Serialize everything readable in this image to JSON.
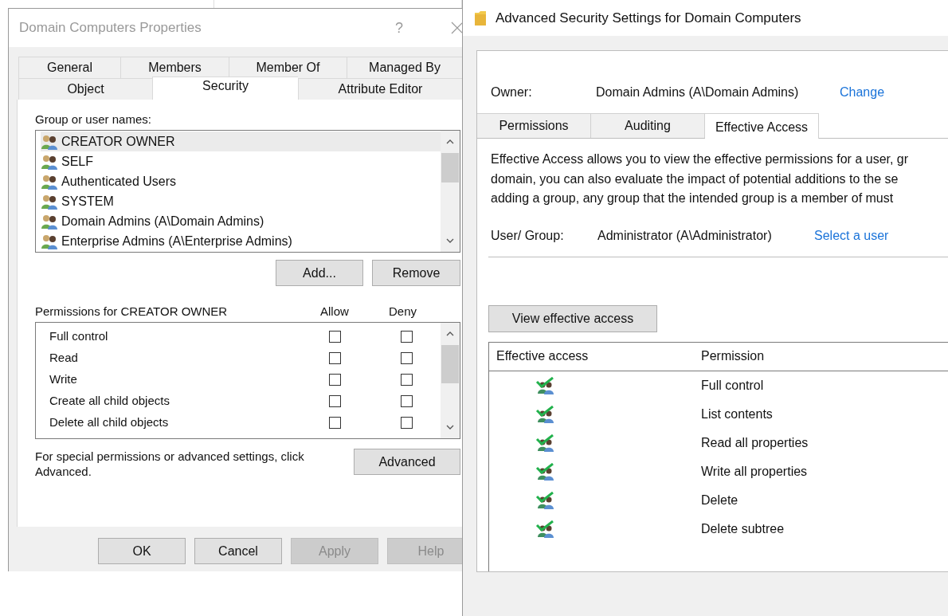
{
  "dialog": {
    "title": "Domain Computers Properties",
    "help_glyph": "?",
    "tab_rows": [
      [
        {
          "label": "General",
          "selected": false
        },
        {
          "label": "Members",
          "selected": false
        },
        {
          "label": "Member Of",
          "selected": false
        },
        {
          "label": "Managed By",
          "selected": false
        }
      ],
      [
        {
          "label": "Object",
          "selected": false
        },
        {
          "label": "Security",
          "selected": true
        },
        {
          "label": "Attribute Editor",
          "selected": false
        }
      ]
    ],
    "group_label": "Group or user names:",
    "groups": [
      {
        "name": "CREATOR OWNER",
        "selected": true
      },
      {
        "name": "SELF",
        "selected": false
      },
      {
        "name": "Authenticated Users",
        "selected": false
      },
      {
        "name": "SYSTEM",
        "selected": false
      },
      {
        "name": "Domain Admins (A\\Domain Admins)",
        "selected": false
      },
      {
        "name": "Enterprise Admins (A\\Enterprise Admins)",
        "selected": false
      }
    ],
    "add_button": "Add...",
    "remove_button": "Remove",
    "permissions_label": "Permissions for CREATOR OWNER",
    "allow_header": "Allow",
    "deny_header": "Deny",
    "permissions": [
      {
        "name": "Full control",
        "allow": false,
        "deny": false
      },
      {
        "name": "Read",
        "allow": false,
        "deny": false
      },
      {
        "name": "Write",
        "allow": false,
        "deny": false
      },
      {
        "name": "Create all child objects",
        "allow": false,
        "deny": false
      },
      {
        "name": "Delete all child objects",
        "allow": false,
        "deny": false
      }
    ],
    "advanced_note": "For special permissions or advanced settings, click Advanced.",
    "advanced_button": "Advanced",
    "footer_buttons": [
      {
        "label": "OK",
        "disabled": false
      },
      {
        "label": "Cancel",
        "disabled": false
      },
      {
        "label": "Apply",
        "disabled": true
      },
      {
        "label": "Help",
        "disabled": true
      }
    ]
  },
  "advanced_window": {
    "title": "Advanced Security Settings for Domain Computers",
    "owner_label": "Owner:",
    "owner_value": "Domain Admins (A\\Domain Admins)",
    "owner_link": "Change",
    "tabs": [
      {
        "label": "Permissions",
        "selected": false
      },
      {
        "label": "Auditing",
        "selected": false
      },
      {
        "label": "Effective Access",
        "selected": true
      }
    ],
    "description_lines": [
      "Effective Access allows you to view the effective permissions for a user, gr",
      "domain, you can also evaluate the impact of potential additions to the se",
      "adding a group, any group that the intended group is a member of must"
    ],
    "user_label": "User/ Group:",
    "user_value": "Administrator (A\\Administrator)",
    "user_link": "Select a user",
    "view_button": "View effective access",
    "table": {
      "columns": [
        "Effective access",
        "Permission"
      ],
      "rows": [
        {
          "permission": "Full control",
          "allowed": true
        },
        {
          "permission": "List contents",
          "allowed": true
        },
        {
          "permission": "Read all properties",
          "allowed": true
        },
        {
          "permission": "Write all properties",
          "allowed": true
        },
        {
          "permission": "Delete",
          "allowed": true
        },
        {
          "permission": "Delete subtree",
          "allowed": true
        }
      ]
    }
  }
}
